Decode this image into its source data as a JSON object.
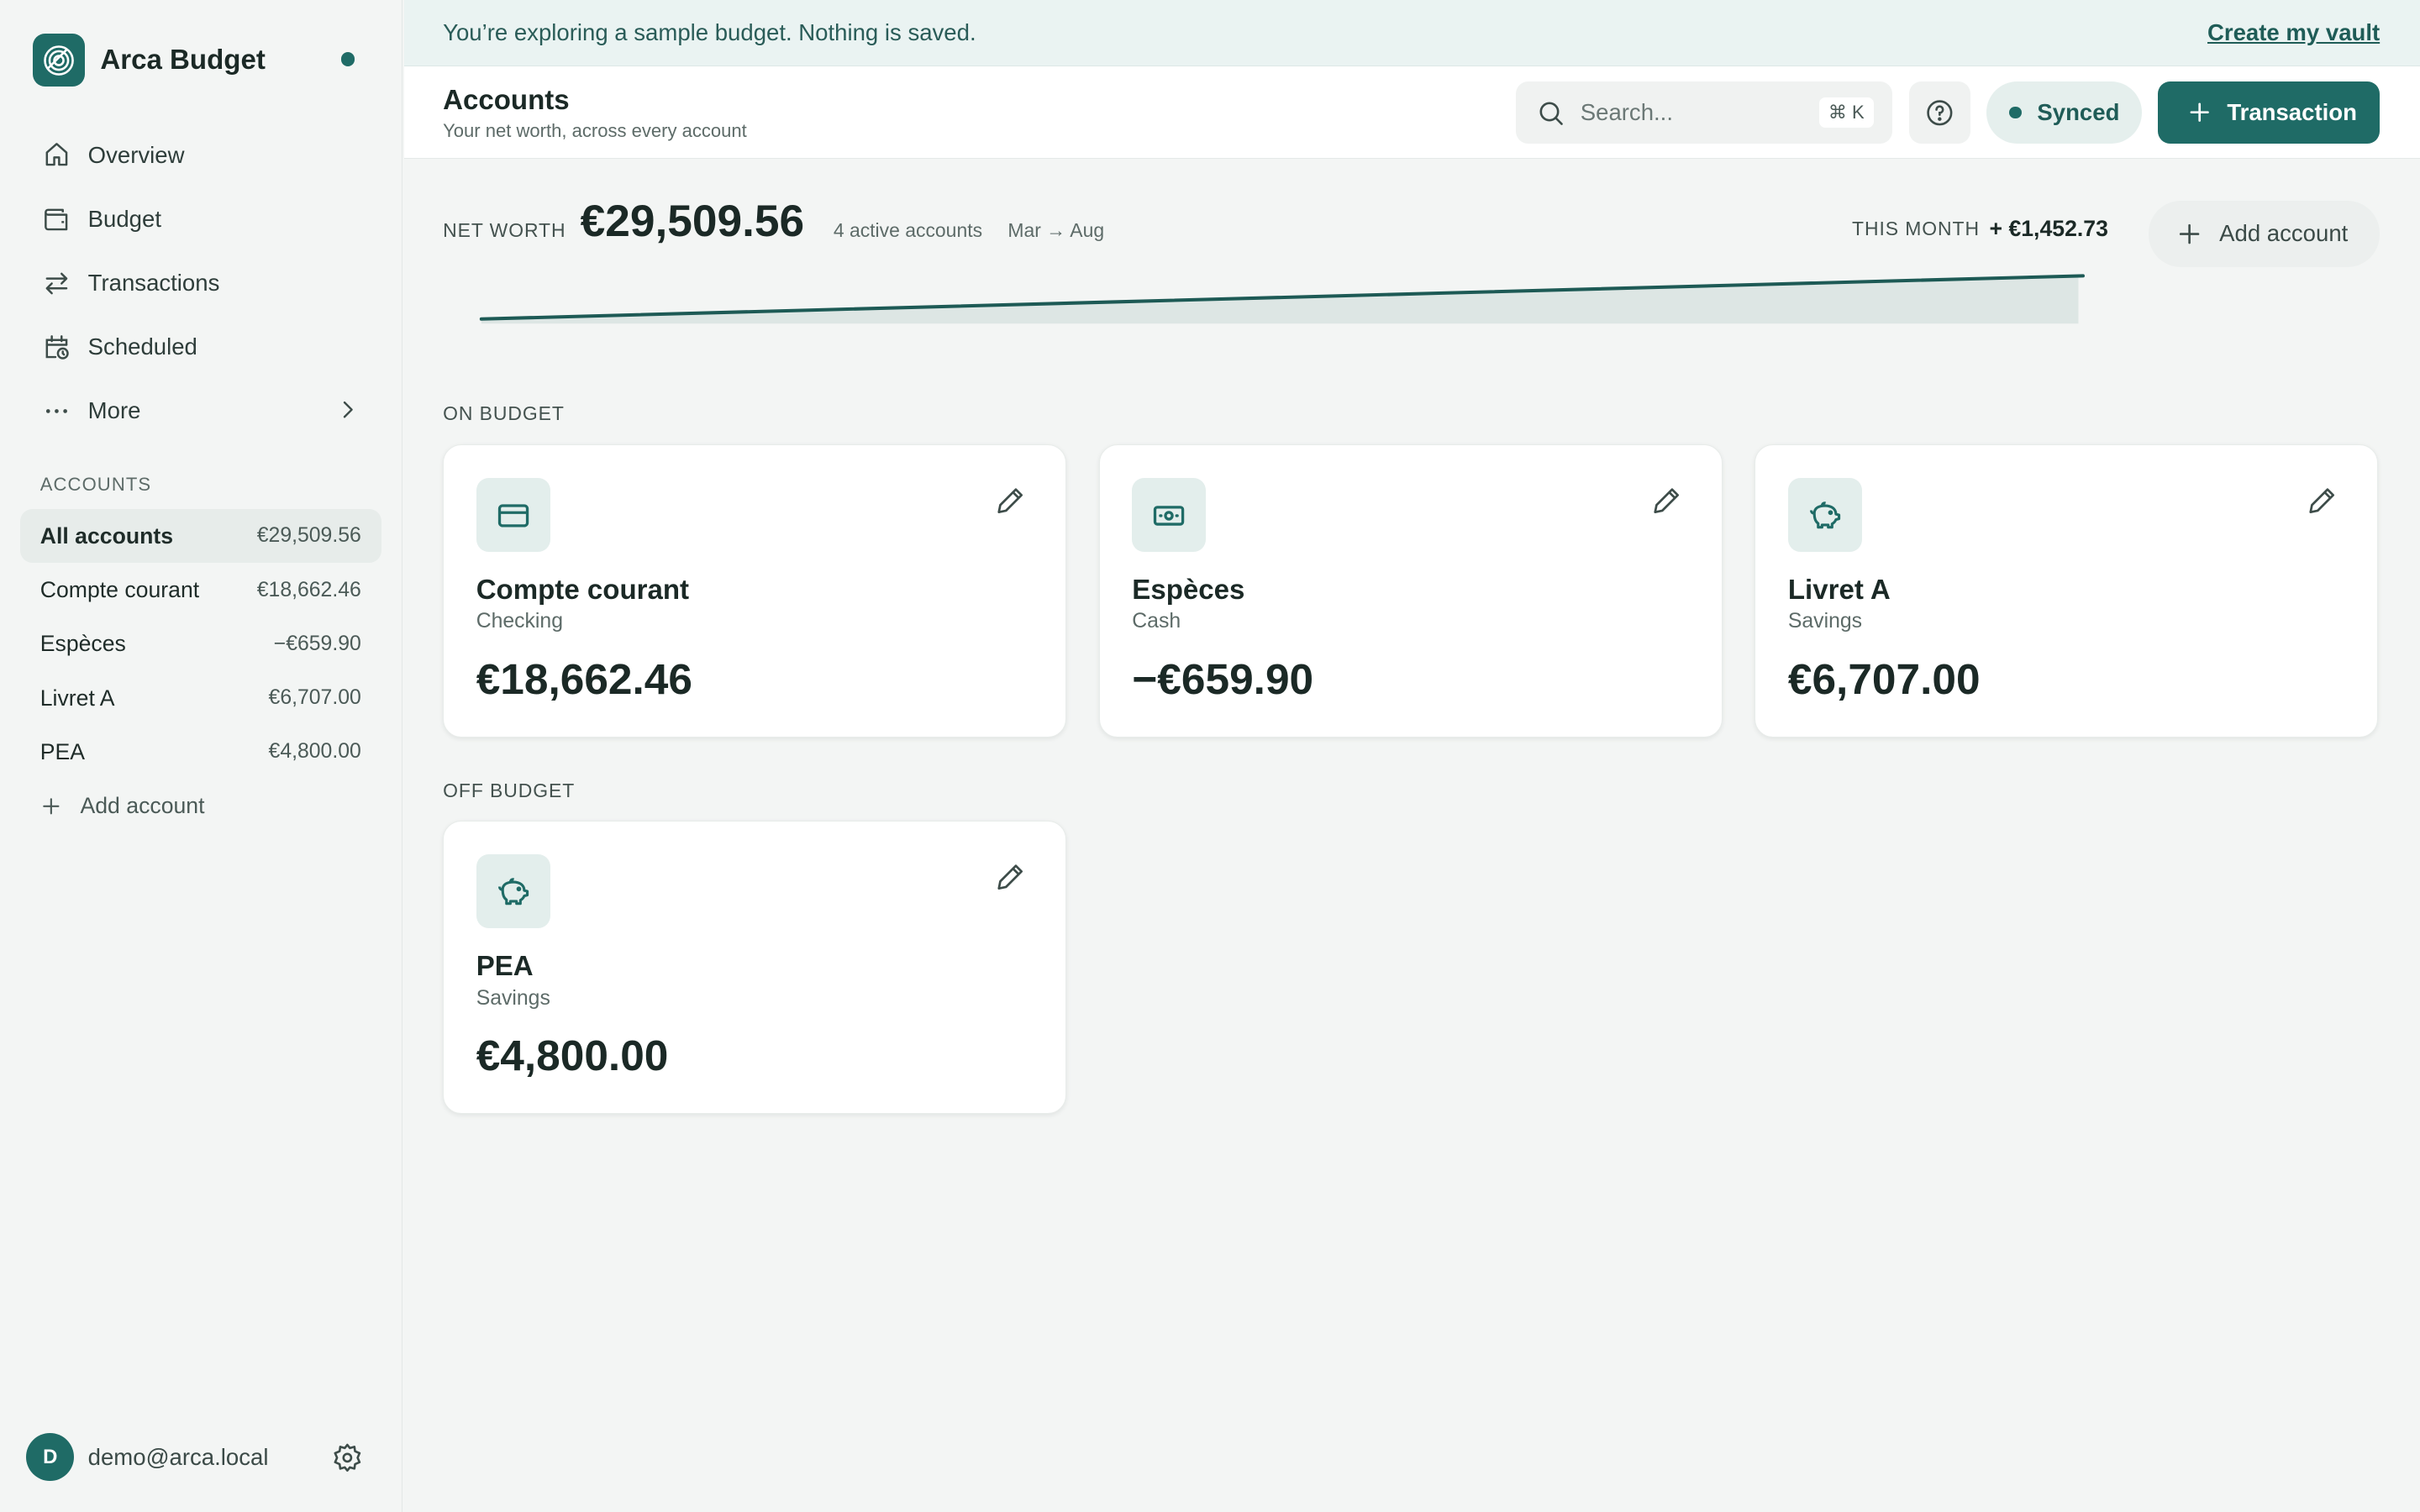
{
  "brand": {
    "name": "Arca Budget"
  },
  "nav": [
    {
      "label": "Overview",
      "icon": "home-icon"
    },
    {
      "label": "Budget",
      "icon": "wallet-icon"
    },
    {
      "label": "Transactions",
      "icon": "arrows-icon"
    },
    {
      "label": "Scheduled",
      "icon": "calendar-clock-icon"
    },
    {
      "label": "More",
      "icon": "ellipsis-icon"
    }
  ],
  "sidebar_accounts": {
    "title": "ACCOUNTS",
    "items": [
      {
        "label": "All accounts",
        "amount": "€29,509.56"
      },
      {
        "label": "Compte courant",
        "amount": "€18,662.46"
      },
      {
        "label": "Espèces",
        "amount": "−€659.90"
      },
      {
        "label": "Livret A",
        "amount": "€6,707.00"
      },
      {
        "label": "PEA",
        "amount": "€4,800.00"
      }
    ],
    "add_label": "Add account"
  },
  "user": {
    "initial": "D",
    "email": "demo@arca.local"
  },
  "banner": {
    "text": "You’re exploring a sample budget. Nothing is saved.",
    "link": "Create my vault"
  },
  "header": {
    "title": "Accounts",
    "subtitle": "Your net worth, across every account",
    "search_placeholder": "Search...",
    "search_shortcut": "⌘ K",
    "sync_status": "Synced",
    "transaction_button": "Transaction"
  },
  "net_worth": {
    "label": "NET WORTH",
    "value": "€29,509.56",
    "active_accounts": "4 active accounts",
    "range": "Mar → Aug",
    "this_month_label": "THIS MONTH",
    "this_month_value": "+ €1,452.73",
    "add_account_label": "Add account",
    "trend": [
      0.0,
      0.2,
      0.4,
      0.6,
      0.8,
      1.0
    ]
  },
  "sections": {
    "on_budget": "ON BUDGET",
    "off_budget": "OFF BUDGET"
  },
  "cards": {
    "on_budget": [
      {
        "name": "Compte courant",
        "type": "Checking",
        "balance": "€18,662.46",
        "icon": "credit-card-icon"
      },
      {
        "name": "Espèces",
        "type": "Cash",
        "balance": "−€659.90",
        "icon": "banknote-icon"
      },
      {
        "name": "Livret A",
        "type": "Savings",
        "balance": "€6,707.00",
        "icon": "piggy-bank-icon"
      }
    ],
    "off_budget": [
      {
        "name": "PEA",
        "type": "Savings",
        "balance": "€4,800.00",
        "icon": "piggy-bank-icon"
      }
    ]
  },
  "colors": {
    "accent": "#1f6b66",
    "accent_light": "#e3eeec",
    "banner_bg": "#eaf3f2",
    "background": "#f3f5f4"
  }
}
